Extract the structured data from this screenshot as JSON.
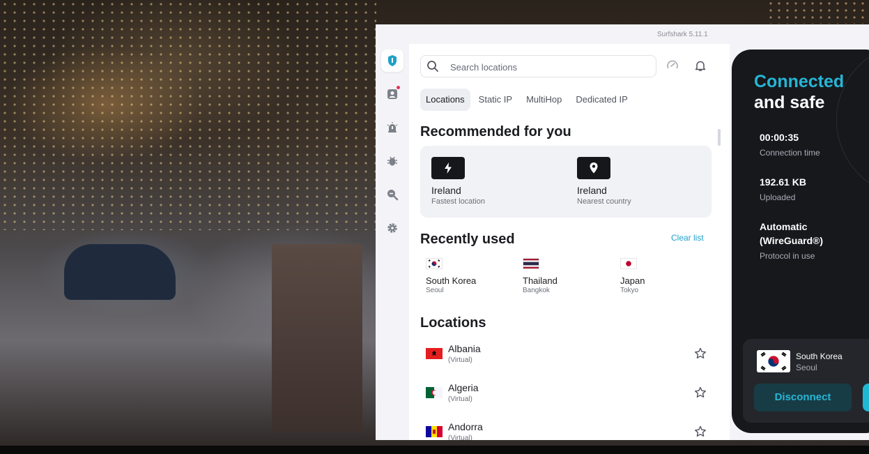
{
  "window": {
    "title": "Surfshark 5.11.1"
  },
  "sidebar": {
    "items": [
      {
        "icon": "surfshark-shield-icon",
        "active": true
      },
      {
        "icon": "account-icon",
        "badge": true
      },
      {
        "icon": "alert-icon"
      },
      {
        "icon": "antivirus-bug-icon"
      },
      {
        "icon": "search-alert-icon"
      },
      {
        "icon": "settings-gear-icon"
      }
    ]
  },
  "search": {
    "placeholder": "Search locations"
  },
  "header_icons": [
    "speed-test-icon",
    "notifications-bell-icon"
  ],
  "tabs": [
    {
      "label": "Locations",
      "active": true
    },
    {
      "label": "Static IP"
    },
    {
      "label": "MultiHop"
    },
    {
      "label": "Dedicated IP"
    }
  ],
  "recommended": {
    "title": "Recommended for you",
    "items": [
      {
        "icon": "lightning-icon",
        "name": "Ireland",
        "sub": "Fastest location"
      },
      {
        "icon": "location-pin-icon",
        "name": "Ireland",
        "sub": "Nearest country"
      }
    ]
  },
  "recent": {
    "title": "Recently used",
    "clear_label": "Clear list",
    "items": [
      {
        "flag": "south-korea-flag",
        "name": "South Korea",
        "city": "Seoul"
      },
      {
        "flag": "thailand-flag",
        "name": "Thailand",
        "city": "Bangkok"
      },
      {
        "flag": "japan-flag",
        "name": "Japan",
        "city": "Tokyo"
      }
    ]
  },
  "locations": {
    "title": "Locations",
    "items": [
      {
        "flag": "albania-flag",
        "name": "Albania",
        "tag": "(Virtual)"
      },
      {
        "flag": "algeria-flag",
        "name": "Algeria",
        "tag": "(Virtual)"
      },
      {
        "flag": "andorra-flag",
        "name": "Andorra",
        "tag": "(Virtual)"
      }
    ]
  },
  "connection": {
    "title_line1": "Connected",
    "title_line2": "and safe",
    "stats": [
      {
        "value": "00:00:35",
        "label": "Connection time"
      },
      {
        "value": "192.61 KB",
        "label": "Uploaded"
      },
      {
        "value_line1": "Automatic",
        "value_line2": "(WireGuard®)",
        "label": "Protocol in use"
      }
    ],
    "server": {
      "flag": "south-korea-flag",
      "name": "South Korea",
      "city": "Seoul"
    },
    "disconnect_label": "Disconnect"
  },
  "colors": {
    "accent": "#27b6d6",
    "dark_panel": "#16181c",
    "link": "#1ea0c9"
  }
}
